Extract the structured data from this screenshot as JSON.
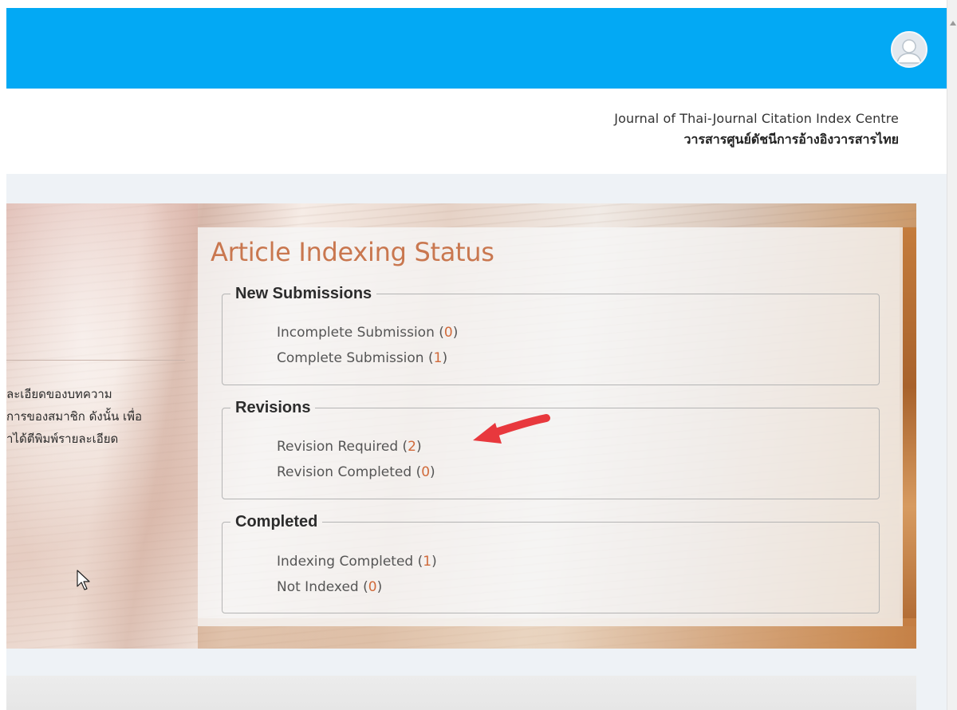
{
  "header": {
    "background_color": "#03a9f4",
    "avatar_icon": "user-avatar-icon"
  },
  "journal": {
    "name_en": "Journal of Thai-Journal Citation Index Centre",
    "name_th": "วารสารศูนย์ดัชนีการอ้างอิงวารสารไทย"
  },
  "intro_text": {
    "line1": "ละเอียดของบทความ",
    "line2": "การของสมาชิก ดังนั้น เพื่อ",
    "line3": "าได้ตีพิมพ์รายละเอียด"
  },
  "status_panel": {
    "title": "Article Indexing Status",
    "title_color": "#c9774f",
    "count_color": "#d06a3a",
    "groups": [
      {
        "legend": "New Submissions",
        "items": [
          {
            "label": "Incomplete Submission",
            "count": "0"
          },
          {
            "label": "Complete Submission",
            "count": "1"
          }
        ]
      },
      {
        "legend": "Revisions",
        "items": [
          {
            "label": "Revision Required",
            "count": "2"
          },
          {
            "label": "Revision Completed",
            "count": "0"
          }
        ]
      },
      {
        "legend": "Completed",
        "items": [
          {
            "label": "Indexing Completed",
            "count": "1"
          },
          {
            "label": "Not Indexed",
            "count": "0"
          }
        ]
      }
    ]
  },
  "annotation": {
    "arrow_color": "#e8383d",
    "arrow_icon": "red-pointer-arrow-icon"
  }
}
